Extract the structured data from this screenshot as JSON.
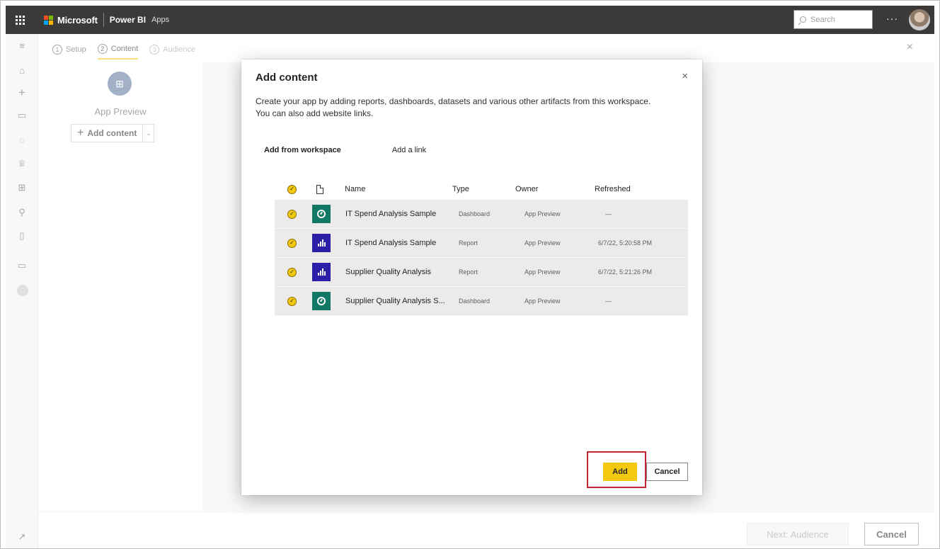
{
  "header": {
    "brand": "Microsoft",
    "product": "Power BI",
    "crumb": "Apps",
    "search_placeholder": "Search",
    "more_label": "···"
  },
  "wizard": {
    "steps": [
      {
        "num": "1",
        "label": "Setup",
        "state": "done"
      },
      {
        "num": "2",
        "label": "Content",
        "state": "active"
      },
      {
        "num": "3",
        "label": "Audience",
        "state": "upcoming"
      }
    ],
    "close_label": "×"
  },
  "left_panel": {
    "app_name": "App Preview",
    "add_content_label": "Add content",
    "plus_label": "+",
    "dropdown_glyph": "⌄"
  },
  "footer": {
    "next_label": "Next: Audience",
    "cancel_label": "Cancel"
  },
  "dialog": {
    "title": "Add content",
    "close_label": "×",
    "description": "Create your app by adding reports, dashboards, datasets and various other artifacts from this workspace. You can also add website links.",
    "tabs": [
      {
        "label": "Add from workspace",
        "active": true
      },
      {
        "label": "Add a link",
        "active": false
      }
    ],
    "columns": {
      "name": "Name",
      "type": "Type",
      "owner": "Owner",
      "refreshed": "Refreshed"
    },
    "items": [
      {
        "name": "IT Spend Analysis Sample",
        "type": "Dashboard",
        "owner": "App Preview",
        "refreshed": "—",
        "icon": "dashboard-icon",
        "selected": true
      },
      {
        "name": "IT Spend Analysis Sample",
        "type": "Report",
        "owner": "App Preview",
        "refreshed": "6/7/22, 5:20:58 PM",
        "icon": "report-icon",
        "selected": true
      },
      {
        "name": "Supplier Quality Analysis",
        "type": "Report",
        "owner": "App Preview",
        "refreshed": "6/7/22, 5:21:26 PM",
        "icon": "report-icon",
        "selected": true
      },
      {
        "name": "Supplier Quality Analysis S...",
        "type": "Dashboard",
        "owner": "App Preview",
        "refreshed": "—",
        "icon": "dashboard-icon",
        "selected": true
      }
    ],
    "add_label": "Add",
    "cancel_label": "Cancel"
  },
  "colors": {
    "accent": "#f2c811",
    "topbar": "#3b3a39",
    "dashboard_badge": "#117865",
    "report_badge": "#2a1fa6",
    "highlight": "#c4262e"
  },
  "rail_icons": [
    "menu-icon",
    "home-icon",
    "create-icon",
    "browse-icon",
    "datahub-icon",
    "goals-icon",
    "apps-icon",
    "deployment-icon",
    "learn-icon",
    "workspaces-icon",
    "workspace-avatar-icon",
    "expand-icon"
  ]
}
